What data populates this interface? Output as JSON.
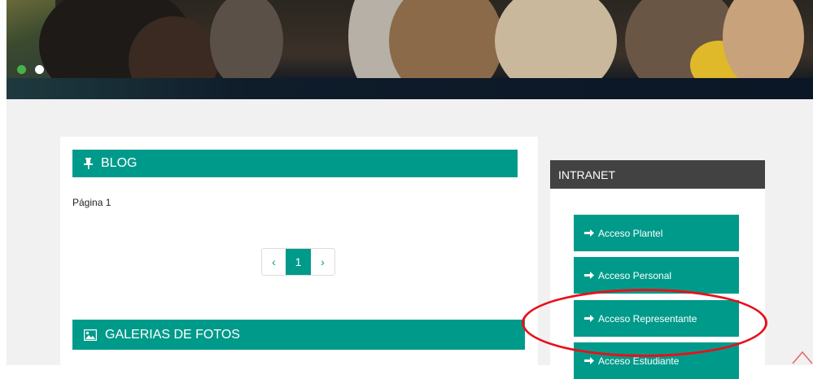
{
  "hero": {
    "slider_dots": [
      "active",
      "inactive"
    ],
    "active_color": "#47b14a"
  },
  "blog": {
    "title": "BLOG",
    "icon": "pin-icon",
    "page_label": "Página 1",
    "pagination": {
      "prev": "‹",
      "current": "1",
      "next": "›"
    }
  },
  "gallery": {
    "title": "GALERIAS DE FOTOS",
    "icon": "image-icon"
  },
  "intranet": {
    "title": "INTRANET",
    "buttons": [
      {
        "label": "Acceso Plantel",
        "icon": "arrow-right-icon"
      },
      {
        "label": "Acceso Personal",
        "icon": "arrow-right-icon"
      },
      {
        "label": "Acceso Representante",
        "icon": "arrow-right-icon"
      },
      {
        "label": "Acceso Estudiante",
        "icon": "arrow-right-icon"
      }
    ]
  },
  "colors": {
    "accent": "#009a8a",
    "dark_header": "#424242",
    "annotation": "#e8101b"
  }
}
